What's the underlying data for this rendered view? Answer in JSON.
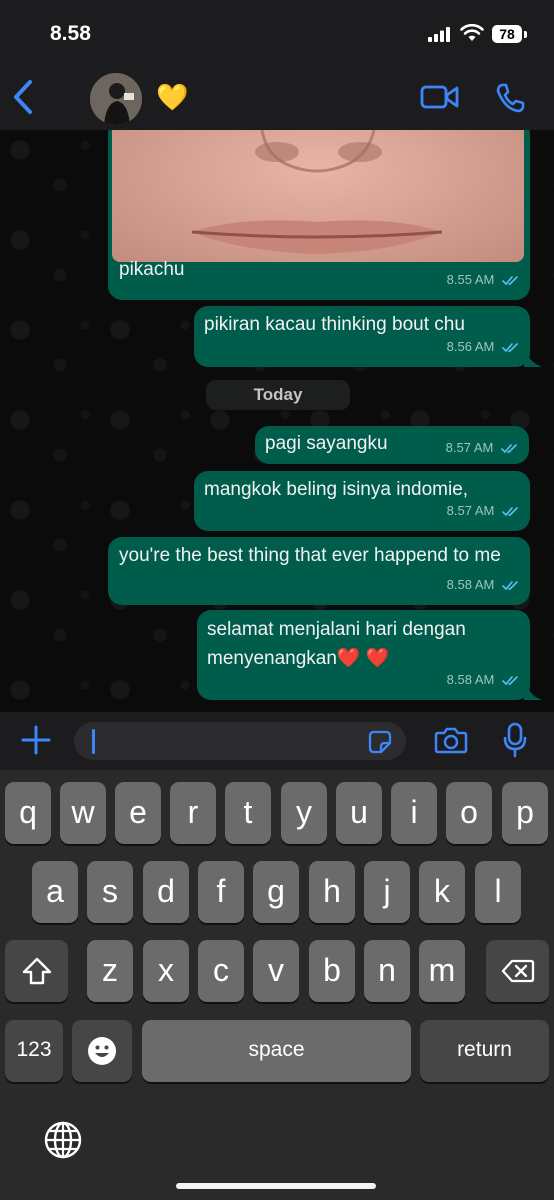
{
  "status_bar": {
    "time": "8.58",
    "battery": "78"
  },
  "header": {
    "contact_name": "💛"
  },
  "chat": {
    "messages": [
      {
        "text": "pikachu",
        "time": "8.55 AM"
      },
      {
        "text": "pikiran kacau thinking bout chu",
        "time": "8.56 AM"
      },
      {
        "text": "pagi sayangku",
        "time": "8.57 AM"
      },
      {
        "text": "mangkok beling isinya indomie,",
        "time": "8.57 AM"
      },
      {
        "text": "you're the best thing that ever happend to me",
        "time": "8.58 AM"
      },
      {
        "text": "selamat menjalani hari dengan menyenangkan❤️ ❤️",
        "time": "8.58 AM"
      }
    ],
    "day_separator": "Today"
  },
  "input": {
    "placeholder": ""
  },
  "keyboard": {
    "row1": [
      "q",
      "w",
      "e",
      "r",
      "t",
      "y",
      "u",
      "i",
      "o",
      "p"
    ],
    "row2": [
      "a",
      "s",
      "d",
      "f",
      "g",
      "h",
      "j",
      "k",
      "l"
    ],
    "row3": [
      "z",
      "x",
      "c",
      "v",
      "b",
      "n",
      "m"
    ],
    "numbers_key": "123",
    "space_key": "space",
    "return_key": "return"
  },
  "colors": {
    "accent": "#3e86f7",
    "bubble": "#005c4b",
    "tick": "#53bdeb"
  },
  "icons": [
    "back-icon",
    "video-call-icon",
    "phone-icon",
    "plus-icon",
    "sticker-icon",
    "camera-icon",
    "microphone-icon",
    "shift-icon",
    "delete-icon",
    "emoji-icon",
    "globe-icon"
  ]
}
